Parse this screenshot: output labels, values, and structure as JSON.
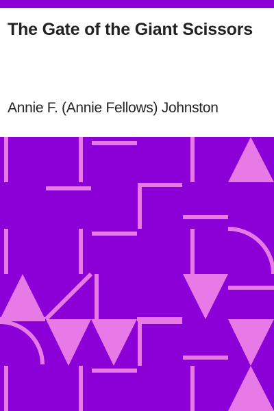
{
  "cover": {
    "title": "The Gate of the Giant Scissors",
    "author": "Annie F. (Annie Fellows) Johnston"
  },
  "colors": {
    "accent": "#8b00d6",
    "pattern": "#e87ae8",
    "text": "#222222",
    "background": "#ffffff"
  }
}
